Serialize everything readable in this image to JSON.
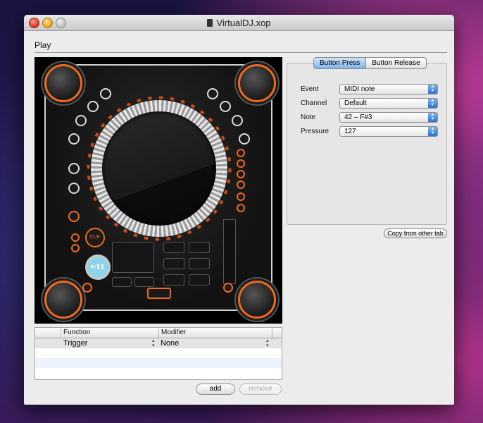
{
  "window": {
    "title": "VirtualDJ.xop"
  },
  "section": {
    "label": "Play"
  },
  "mapping_table": {
    "columns": [
      "Function",
      "Modifier"
    ],
    "rows": [
      {
        "function": "Trigger",
        "modifier": "None"
      }
    ]
  },
  "table_buttons": {
    "add": "add",
    "remove": "remove"
  },
  "tabs": {
    "items": [
      "Button Press",
      "Button Release"
    ],
    "active": "Button Press"
  },
  "properties": [
    {
      "label": "Event",
      "value": "MIDI note"
    },
    {
      "label": "Channel",
      "value": "Default"
    },
    {
      "label": "Note",
      "value": "42 – F#3"
    },
    {
      "label": "Pressure",
      "value": "127"
    }
  ],
  "copy_button": "Copy from other tab",
  "controller_labels": {
    "cue": "CUE",
    "play": "▶/❚❚"
  },
  "colors": {
    "accent_orange": "#ef6a1e",
    "play_button": "#8fd3ea",
    "tab_active": "#7fb2ea"
  }
}
